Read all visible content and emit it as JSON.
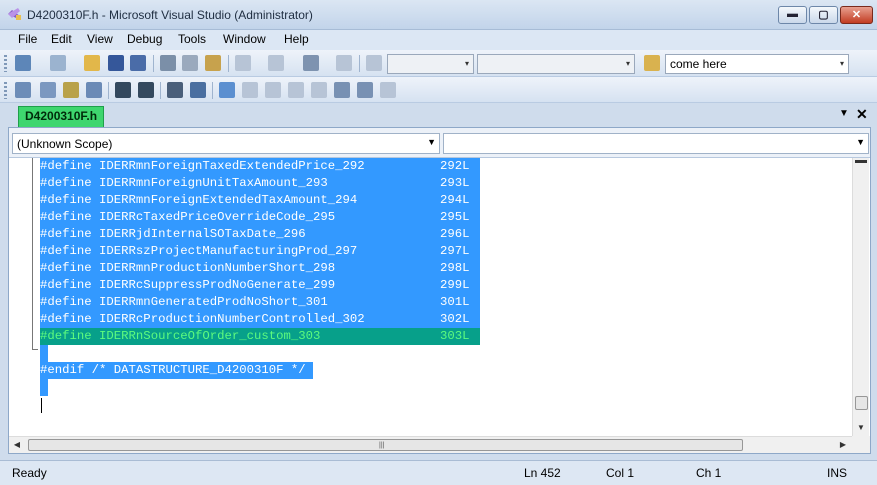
{
  "window": {
    "title": "D4200310F.h - Microsoft Visual Studio (Administrator)",
    "min_glyph": "▬",
    "max_glyph": "▢",
    "close_glyph": "✕"
  },
  "menu": [
    "File",
    "Edit",
    "View",
    "Debug",
    "Tools",
    "Window",
    "Help"
  ],
  "toolbar": {
    "find_combo_value": "come here",
    "solution_config_value": "",
    "solution_platform_value": "",
    "dropdown_glyph": "▾"
  },
  "tab": {
    "label": "D4200310F.h",
    "dropdown_glyph": "▼",
    "close_glyph": "✕"
  },
  "editor": {
    "scope_left": "(Unknown Scope)",
    "scope_right": "",
    "lines": [
      {
        "text": "#define IDERRmnForeignTaxedExtendedPrice_292",
        "num": "292L"
      },
      {
        "text": "#define IDERRmnForeignUnitTaxAmount_293",
        "num": "293L"
      },
      {
        "text": "#define IDERRmnForeignExtendedTaxAmount_294",
        "num": "294L"
      },
      {
        "text": "#define IDERRcTaxedPriceOverrideCode_295",
        "num": "295L"
      },
      {
        "text": "#define IDERRjdInternalSOTaxDate_296",
        "num": "296L"
      },
      {
        "text": "#define IDERRszProjectManufacturingProd_297",
        "num": "297L"
      },
      {
        "text": "#define IDERRmnProductionNumberShort_298",
        "num": "298L"
      },
      {
        "text": "#define IDERRcSuppressProdNoGenerate_299",
        "num": "299L"
      },
      {
        "text": "#define IDERRmnGeneratedProdNoShort_301",
        "num": "301L"
      },
      {
        "text": "#define IDERRcProductionNumberControlled_302",
        "num": "302L"
      },
      {
        "text": "#define IDERRnSourceOfOrder_custom_303",
        "num": "303L"
      }
    ],
    "endif_line": "#endif /* DATASTRUCTURE_D4200310F */ "
  },
  "status": {
    "ready": "Ready",
    "line": "Ln 452",
    "col": "Col 1",
    "ch": "Ch 1",
    "mode": "INS"
  },
  "colors": {
    "selection": "#3399ff",
    "current_line": "#07a08a",
    "tab_active": "#3ed66e"
  }
}
